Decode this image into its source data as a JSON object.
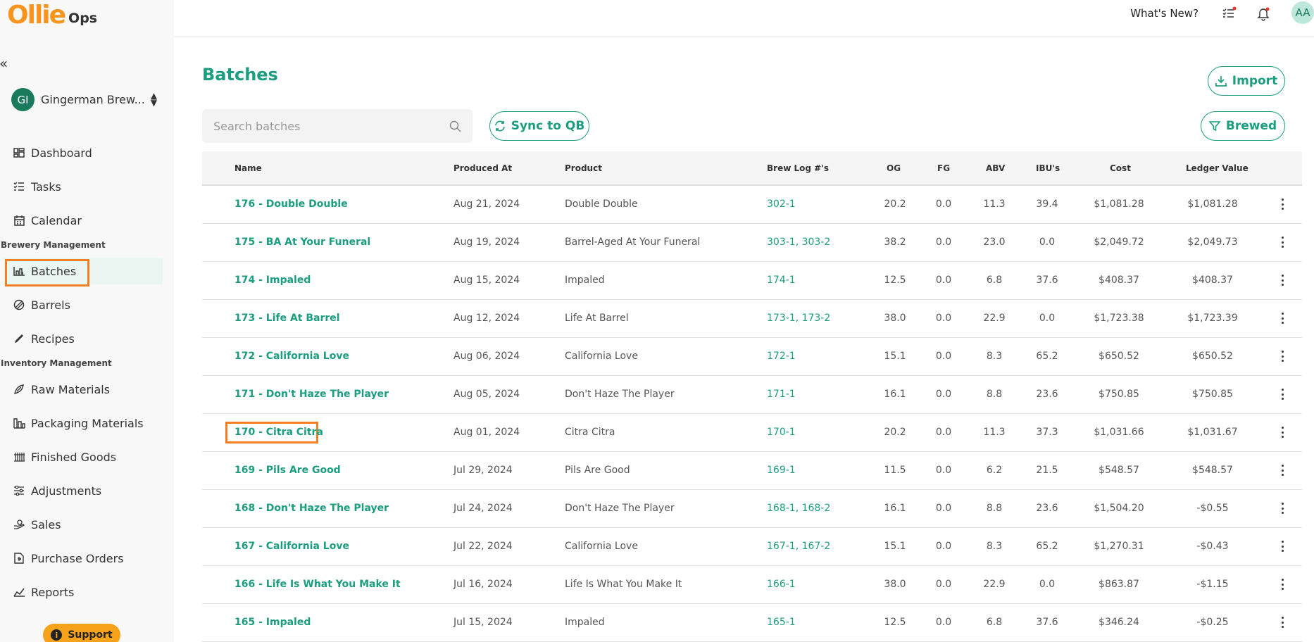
{
  "app": {
    "logo_main": "Ollie",
    "logo_sub": "Ops"
  },
  "org": {
    "initials": "GI",
    "name": "Gingerman Brew..."
  },
  "sidebar": {
    "items": [
      {
        "label": "Dashboard",
        "icon": "dashboard-icon"
      },
      {
        "label": "Tasks",
        "icon": "tasks-icon"
      },
      {
        "label": "Calendar",
        "icon": "calendar-icon"
      },
      {
        "label": "Batches",
        "icon": "batches-icon"
      },
      {
        "label": "Barrels",
        "icon": "barrels-icon"
      },
      {
        "label": "Recipes",
        "icon": "recipes-icon"
      },
      {
        "label": "Raw Materials",
        "icon": "raw-materials-icon"
      },
      {
        "label": "Packaging Materials",
        "icon": "packaging-icon"
      },
      {
        "label": "Finished Goods",
        "icon": "finished-goods-icon"
      },
      {
        "label": "Adjustments",
        "icon": "adjustments-icon"
      },
      {
        "label": "Sales",
        "icon": "sales-icon"
      },
      {
        "label": "Purchase Orders",
        "icon": "purchase-orders-icon"
      },
      {
        "label": "Reports",
        "icon": "reports-icon"
      }
    ],
    "sections": {
      "brewery": "Brewery Management",
      "inventory": "Inventory Management"
    },
    "active": "Batches",
    "support_label": "Support"
  },
  "topbar": {
    "whats_new": "What's New?",
    "user_initials": "AA"
  },
  "page": {
    "title": "Batches",
    "import_label": "Import",
    "sync_label": "Sync to QB",
    "filter_label": "Brewed",
    "search_placeholder": "Search batches"
  },
  "table": {
    "headers": [
      "Name",
      "Produced At",
      "Product",
      "Brew Log #'s",
      "OG",
      "FG",
      "ABV",
      "IBU's",
      "Cost",
      "Ledger Value"
    ],
    "rows": [
      {
        "name": "176 - Double Double",
        "produced": "Aug 21, 2024",
        "product": "Double Double",
        "logs": [
          "302-1"
        ],
        "og": "20.2",
        "fg": "0.0",
        "abv": "11.3",
        "ibu": "39.4",
        "cost": "$1,081.28",
        "ledger": "$1,081.28"
      },
      {
        "name": "175 - BA At Your Funeral",
        "produced": "Aug 19, 2024",
        "product": "Barrel-Aged At Your Funeral",
        "logs": [
          "303-1",
          "303-2"
        ],
        "og": "38.2",
        "fg": "0.0",
        "abv": "23.0",
        "ibu": "0.0",
        "cost": "$2,049.72",
        "ledger": "$2,049.73"
      },
      {
        "name": "174 - Impaled",
        "produced": "Aug 15, 2024",
        "product": "Impaled",
        "logs": [
          "174-1"
        ],
        "og": "12.5",
        "fg": "0.0",
        "abv": "6.8",
        "ibu": "37.6",
        "cost": "$408.37",
        "ledger": "$408.37"
      },
      {
        "name": "173 - Life At Barrel",
        "produced": "Aug 12, 2024",
        "product": "Life At Barrel",
        "logs": [
          "173-1",
          "173-2"
        ],
        "og": "38.0",
        "fg": "0.0",
        "abv": "22.9",
        "ibu": "0.0",
        "cost": "$1,723.38",
        "ledger": "$1,723.39"
      },
      {
        "name": "172 - California Love",
        "produced": "Aug 06, 2024",
        "product": "California Love",
        "logs": [
          "172-1"
        ],
        "og": "15.1",
        "fg": "0.0",
        "abv": "8.3",
        "ibu": "65.2",
        "cost": "$650.52",
        "ledger": "$650.52"
      },
      {
        "name": "171 - Don't Haze The Player",
        "produced": "Aug 05, 2024",
        "product": "Don't Haze The Player",
        "logs": [
          "171-1"
        ],
        "og": "16.1",
        "fg": "0.0",
        "abv": "8.8",
        "ibu": "23.6",
        "cost": "$750.85",
        "ledger": "$750.85"
      },
      {
        "name": "170 - Citra Citra",
        "produced": "Aug 01, 2024",
        "product": "Citra Citra",
        "logs": [
          "170-1"
        ],
        "og": "20.2",
        "fg": "0.0",
        "abv": "11.3",
        "ibu": "37.3",
        "cost": "$1,031.66",
        "ledger": "$1,031.67",
        "highlight": true
      },
      {
        "name": "169 - Pils Are Good",
        "produced": "Jul 29, 2024",
        "product": "Pils Are Good",
        "logs": [
          "169-1"
        ],
        "og": "11.5",
        "fg": "0.0",
        "abv": "6.2",
        "ibu": "21.5",
        "cost": "$548.57",
        "ledger": "$548.57"
      },
      {
        "name": "168 - Don't Haze The Player",
        "produced": "Jul 24, 2024",
        "product": "Don't Haze The Player",
        "logs": [
          "168-1",
          "168-2"
        ],
        "og": "16.1",
        "fg": "0.0",
        "abv": "8.8",
        "ibu": "23.6",
        "cost": "$1,504.20",
        "ledger": "-$0.55"
      },
      {
        "name": "167 - California Love",
        "produced": "Jul 22, 2024",
        "product": "California Love",
        "logs": [
          "167-1",
          "167-2"
        ],
        "og": "15.1",
        "fg": "0.0",
        "abv": "8.3",
        "ibu": "65.2",
        "cost": "$1,270.31",
        "ledger": "-$0.43"
      },
      {
        "name": "166 - Life Is What You Make It",
        "produced": "Jul 16, 2024",
        "product": "Life Is What You Make It",
        "logs": [
          "166-1"
        ],
        "og": "38.0",
        "fg": "0.0",
        "abv": "22.9",
        "ibu": "0.0",
        "cost": "$863.87",
        "ledger": "-$1.15"
      },
      {
        "name": "165 - Impaled",
        "produced": "Jul 15, 2024",
        "product": "Impaled",
        "logs": [
          "165-1"
        ],
        "og": "12.5",
        "fg": "0.0",
        "abv": "6.8",
        "ibu": "37.6",
        "cost": "$346.24",
        "ledger": "-$0.25"
      }
    ]
  },
  "colors": {
    "brand": "#f7941d",
    "accent": "#1b9e7f",
    "highlight": "#f47f24"
  }
}
